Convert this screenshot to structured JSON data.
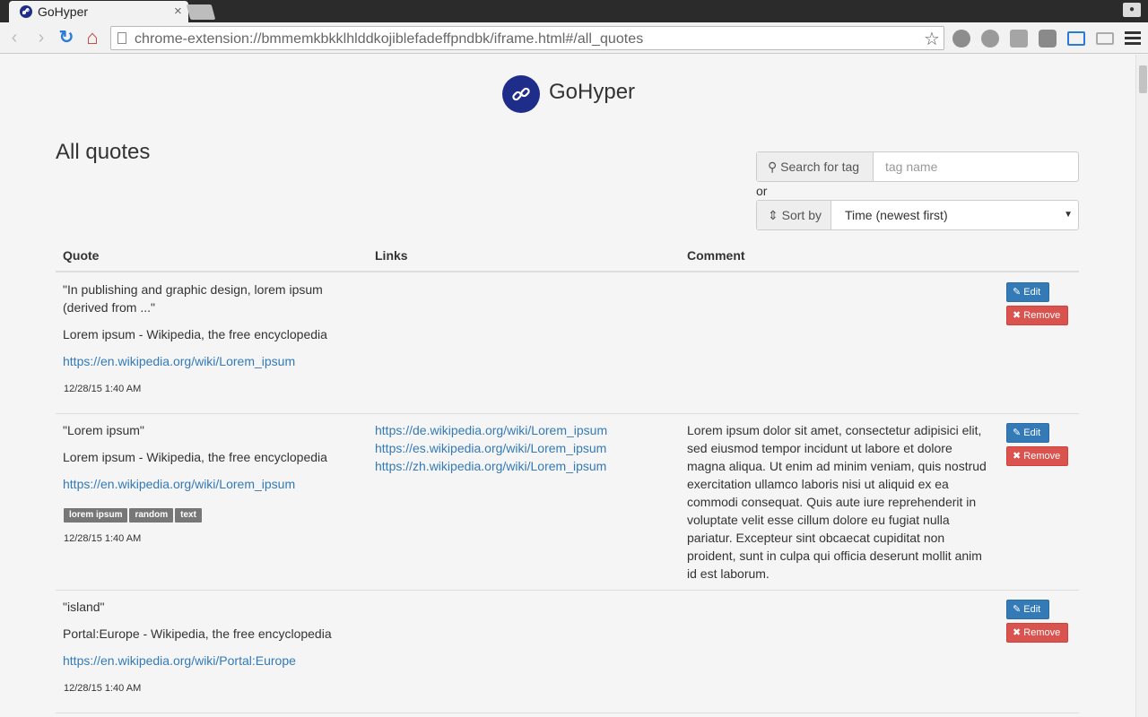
{
  "browser": {
    "tab_title": "GoHyper",
    "tab_close": "×",
    "url": "chrome-extension://bmmemkbkklhlddkojiblefadeffpndbk/iframe.html#/all_quotes",
    "star": "☆",
    "back": "‹",
    "forward": "›",
    "reload": "↻",
    "home": "⌂"
  },
  "app": {
    "brand": "GoHyper",
    "page_title": "All quotes"
  },
  "filters": {
    "search_label": "Search for tag",
    "search_placeholder": "tag name",
    "or_text": "or",
    "sort_label": "Sort by",
    "sort_value": "Time (newest first)",
    "caret": "▼"
  },
  "table": {
    "headers": {
      "quote": "Quote",
      "links": "Links",
      "comment": "Comment"
    },
    "rows": [
      {
        "quote": "\"In publishing and graphic design, lorem ipsum (derived from ...\"",
        "title": "Lorem ipsum - Wikipedia, the free encyclopedia",
        "url": "https://en.wikipedia.org/wiki/Lorem_ipsum",
        "tags": [],
        "time": "12/28/15 1:40 AM",
        "links": [],
        "comment": "",
        "edit": "Edit",
        "remove": "Remove"
      },
      {
        "quote": "\"Lorem ipsum\"",
        "title": "Lorem ipsum - Wikipedia, the free encyclopedia",
        "url": "https://en.wikipedia.org/wiki/Lorem_ipsum",
        "tags": [
          "lorem ipsum",
          "random",
          "text"
        ],
        "time": "12/28/15 1:40 AM",
        "links": [
          "https://de.wikipedia.org/wiki/Lorem_ipsum",
          "https://es.wikipedia.org/wiki/Lorem_ipsum",
          "https://zh.wikipedia.org/wiki/Lorem_ipsum"
        ],
        "comment": "Lorem ipsum dolor sit amet, consectetur adipisici elit, sed eiusmod tempor incidunt ut labore et dolore magna aliqua. Ut enim ad minim veniam, quis nostrud exercitation ullamco laboris nisi ut aliquid ex ea commodi consequat. Quis aute iure reprehenderit in voluptate velit esse cillum dolore eu fugiat nulla pariatur. Excepteur sint obcaecat cupiditat non proident, sunt in culpa qui officia deserunt mollit anim id est laborum.",
        "edit": "Edit",
        "remove": "Remove"
      },
      {
        "quote": "\"island\"",
        "title": "Portal:Europe - Wikipedia, the free encyclopedia",
        "url": "https://en.wikipedia.org/wiki/Portal:Europe",
        "tags": [],
        "time": "12/28/15 1:40 AM",
        "links": [],
        "comment": "",
        "edit": "Edit",
        "remove": "Remove"
      }
    ]
  }
}
